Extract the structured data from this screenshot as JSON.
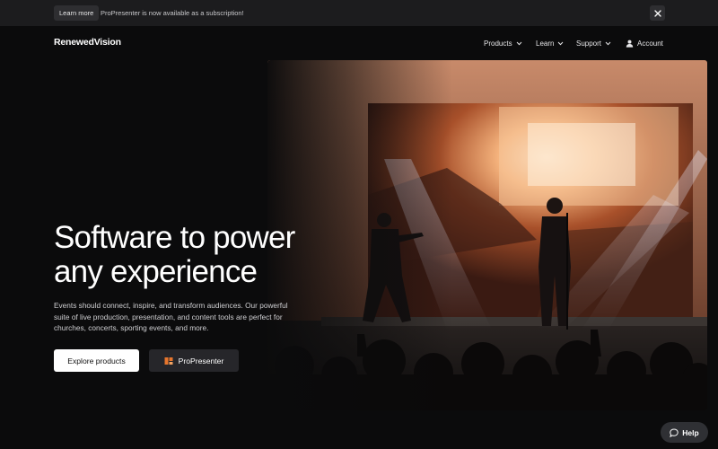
{
  "announcement": {
    "button_label": "Learn more",
    "text": "ProPresenter is now available as a subscription!",
    "close_icon": "close-icon"
  },
  "nav": {
    "logo": "RenewedVision",
    "items": [
      {
        "label": "Products",
        "icon": "chevron-down-icon"
      },
      {
        "label": "Learn",
        "icon": "chevron-down-icon"
      },
      {
        "label": "Support",
        "icon": "chevron-down-icon"
      },
      {
        "label": "Account",
        "icon": "user-icon"
      }
    ]
  },
  "hero": {
    "headline_line1": "Software to power",
    "headline_line2": "any experience",
    "description": "Events should connect, inspire, and transform audiences. Our powerful suite of live production, presentation, and content tools are perfect for churches, concerts, sporting events, and more.",
    "primary_button": "Explore products",
    "secondary_button": "ProPresenter",
    "secondary_icon": "propresenter-logo-icon"
  },
  "help": {
    "label": "Help",
    "icon": "chat-bubble-icon"
  },
  "colors": {
    "background": "#0b0b0c",
    "announcement_bg": "#1c1c1e",
    "accent_orange": "#e8762d"
  }
}
